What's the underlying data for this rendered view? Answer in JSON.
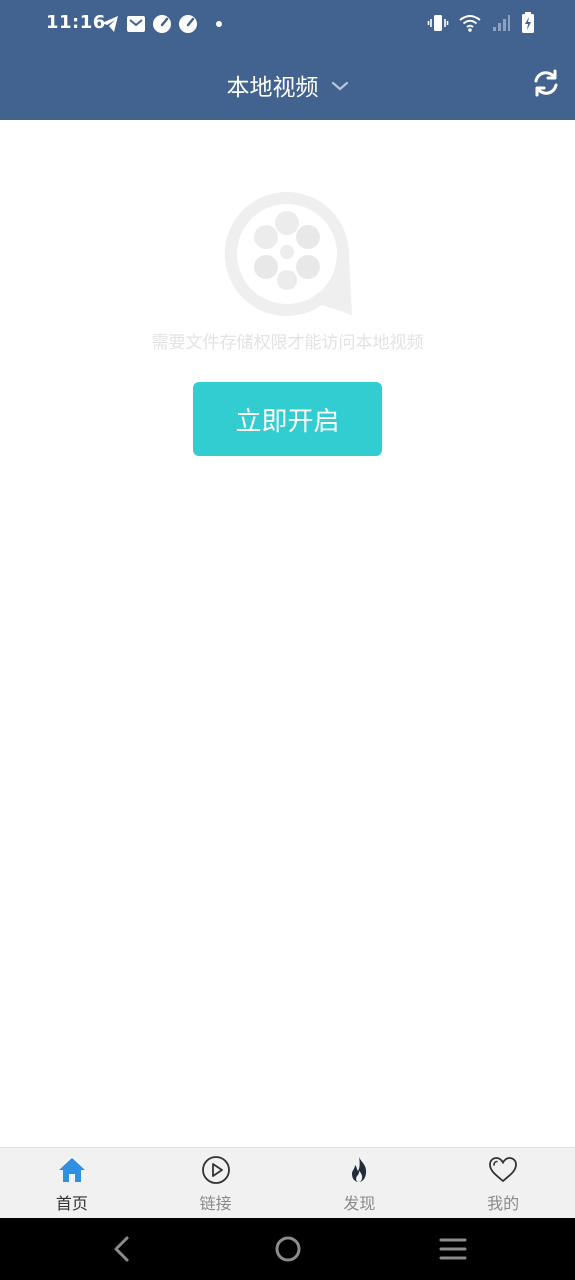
{
  "status_bar": {
    "time": "11:16",
    "left_icons": [
      "telegram-icon",
      "mail-icon",
      "speed-icon",
      "speed-icon"
    ],
    "right_icons": [
      "vibrate-icon",
      "wifi-icon",
      "signal-icon",
      "battery-charging-icon"
    ]
  },
  "header": {
    "title": "本地视频",
    "dropdown_icon": "chevron-down-icon",
    "refresh_icon": "refresh-icon",
    "background_color": "#42628f"
  },
  "main": {
    "empty_icon": "film-reel-icon",
    "hint": "需要文件存储权限才能访问本地视频",
    "open_button_label": "立即开启",
    "button_color": "#32cdd0"
  },
  "bottom_nav": {
    "items": [
      {
        "label": "首页",
        "icon": "home-icon",
        "active": true
      },
      {
        "label": "链接",
        "icon": "play-circle-icon",
        "active": false
      },
      {
        "label": "发现",
        "icon": "flame-icon",
        "active": false
      },
      {
        "label": "我的",
        "icon": "heart-icon",
        "active": false
      }
    ],
    "active_color": "#2f8fe0"
  },
  "system_nav": {
    "buttons": [
      "back-icon",
      "home-circle-icon",
      "menu-icon"
    ]
  }
}
